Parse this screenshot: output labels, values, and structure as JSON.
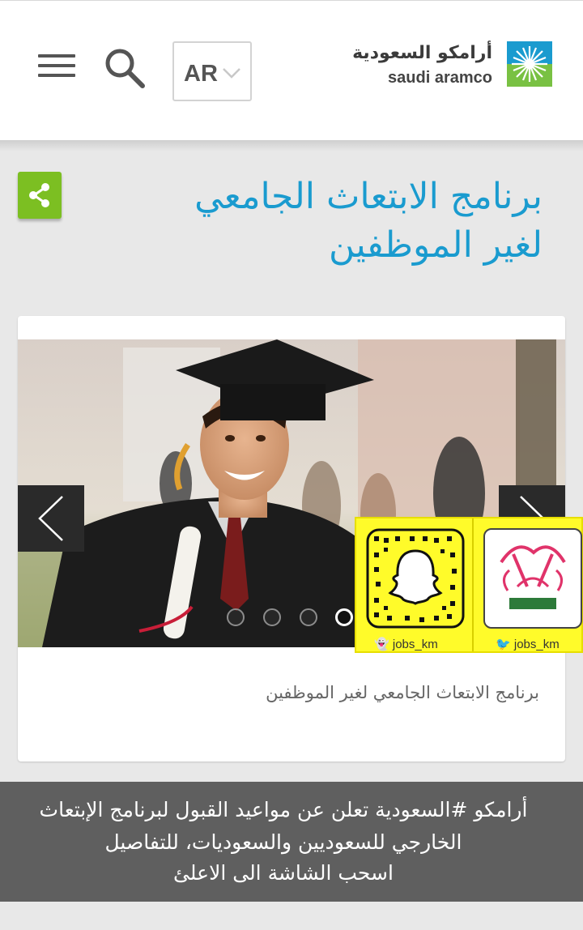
{
  "header": {
    "menu_icon": "hamburger-icon",
    "search_icon": "search-icon",
    "language": "AR",
    "logo": {
      "arabic": "أرامكو السعودية",
      "english": "saudi aramco"
    }
  },
  "page": {
    "share_icon": "share-icon",
    "title_line1": "برنامج الابتعاث الجامعي",
    "title_line2": "لغير الموظفين",
    "title_color": "#1a9bcf",
    "share_color": "#7cbf22"
  },
  "carousel": {
    "slide_count": 4,
    "active_index": 3,
    "prev_icon": "chevron-left-icon",
    "next_icon": "chevron-right-icon",
    "caption": "برنامج الابتعاث الجامعي لغير الموظفين"
  },
  "overlay": {
    "snapchat_handle": "jobs_km",
    "twitter_handle": "jobs_km",
    "background": "#fffb2a"
  },
  "banner": {
    "line1": "أرامكو #السعودية تعلن عن مواعيد القبول لبرنامج الإبتعاث",
    "line2": "الخارجي للسعوديين والسعوديات، للتفاصيل",
    "line3": "اسحب الشاشة الى الاعلئ"
  }
}
